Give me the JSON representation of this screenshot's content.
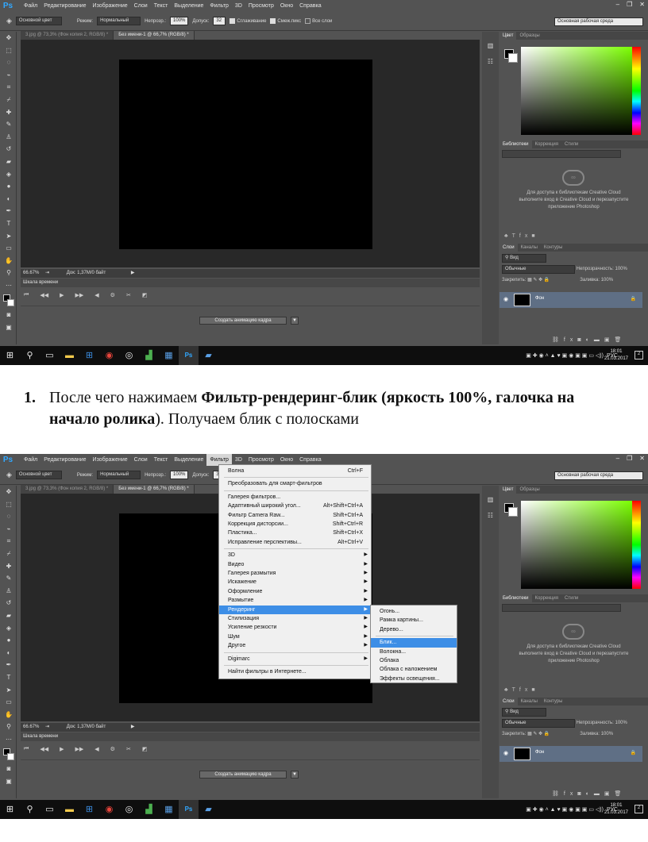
{
  "menu": [
    "Файл",
    "Редактирование",
    "Изображение",
    "Слои",
    "Текст",
    "Выделение",
    "Фильтр",
    "3D",
    "Просмотр",
    "Окно",
    "Справка"
  ],
  "options": {
    "mode_label": "Основной цвет",
    "blend_label": "Режим:",
    "blend_value": "Нормальный",
    "opacity_label": "Непрозр.:",
    "opacity_value": "100%",
    "tolerance_label": "Допуск:",
    "tolerance_value": "32",
    "smoothing": "Сглаживание",
    "contiguous": "Смеж.пикс",
    "all_layers": "Все слои",
    "workspace": "Основная рабочая среда"
  },
  "tabs": [
    "3.jpg @ 73,3% (Фон копия 2, RGB/8) *",
    "Без имени-1 @ 66,7% (RGB/8) *"
  ],
  "status": {
    "zoom": "66.67%",
    "doc": "Док: 1,37M/0 байт"
  },
  "timeline": {
    "title": "Шкала времени",
    "create_button": "Создать анимацию кадра"
  },
  "panels": {
    "color_tabs": [
      "Цвет",
      "Образцы"
    ],
    "lib_tabs": [
      "Библиотеки",
      "Коррекция",
      "Стили"
    ],
    "lib_message": "Для доступа к библиотекам Creative Cloud выполните вход в Creative Cloud и перезапустите приложение Photoshop",
    "layer_tabs": [
      "Слои",
      "Каналы",
      "Контуры"
    ],
    "kind": "Вид",
    "blend": "Обычные",
    "opacity_label": "Непрозрачность:",
    "opacity_value": "100%",
    "lock_label": "Закрепить:",
    "fill_label": "Заливка:",
    "fill_value": "100%",
    "layer_name": "Фон"
  },
  "taskbar": {
    "lang": "РУС",
    "time": "18:01",
    "date": "21.03.2017",
    "notif": "2"
  },
  "caption": {
    "number": "1.",
    "text_start": "После чего нажимаем ",
    "bold": "Фильтр-рендеринг-блик (яркость 100%, галочка на начало ролика",
    "text_end": "). Получаем блик с полосками"
  },
  "filter_menu": [
    {
      "label": "Волна",
      "shortcut": "Ctrl+F"
    },
    {
      "label": "Преобразовать для смарт-фильтров"
    },
    {
      "label": "Галерея фильтров..."
    },
    {
      "label": "Адаптивный широкий угол...",
      "shortcut": "Alt+Shift+Ctrl+A"
    },
    {
      "label": "Фильтр Camera Raw...",
      "shortcut": "Shift+Ctrl+A"
    },
    {
      "label": "Коррекция дисторсии...",
      "shortcut": "Shift+Ctrl+R"
    },
    {
      "label": "Пластика...",
      "shortcut": "Shift+Ctrl+X"
    },
    {
      "label": "Исправление перспективы...",
      "shortcut": "Alt+Ctrl+V"
    },
    {
      "label": "3D"
    },
    {
      "label": "Видео"
    },
    {
      "label": "Галерея размытия"
    },
    {
      "label": "Искажение"
    },
    {
      "label": "Оформление"
    },
    {
      "label": "Размытие"
    },
    {
      "label": "Рендеринг"
    },
    {
      "label": "Стилизация"
    },
    {
      "label": "Усиление резкости"
    },
    {
      "label": "Шум"
    },
    {
      "label": "Другое"
    },
    {
      "label": "Digimarc"
    },
    {
      "label": "Найти фильтры в Интернете..."
    }
  ],
  "render_submenu": [
    "Огонь...",
    "Рамка картины...",
    "Дерево...",
    "Блик...",
    "Волокна...",
    "Облака",
    "Облака с наложением",
    "Эффекты освещения..."
  ]
}
